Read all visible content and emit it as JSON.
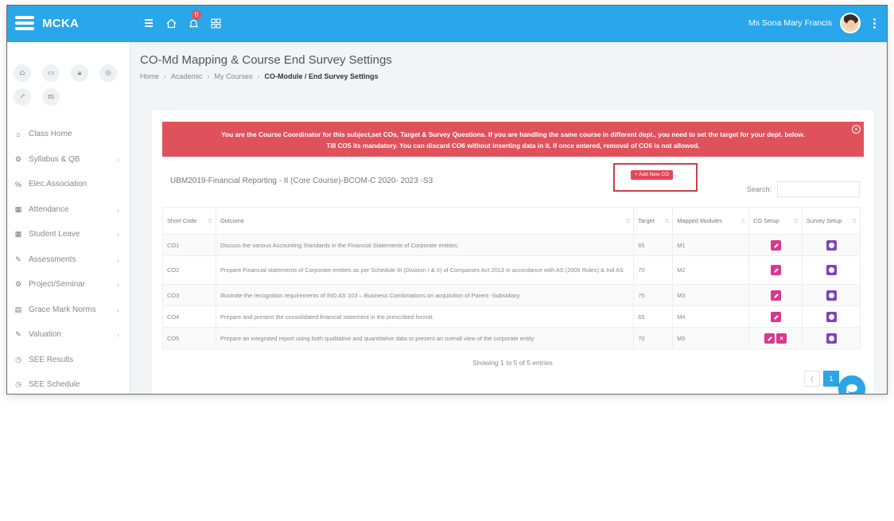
{
  "app": {
    "name": "MCKA"
  },
  "topbar": {
    "notification_count": "0",
    "user_name": "Ms Sona Mary Francis",
    "icons": [
      "list-icon",
      "home-icon",
      "bell-icon",
      "grid-icon"
    ]
  },
  "sidebar": {
    "quick_icons": [
      "home-icon",
      "id-card-icon",
      "lock-icon",
      "eye-icon",
      "external-link-icon",
      "m-icon"
    ],
    "quick_m_label": "m",
    "items": [
      {
        "label": "Class Home",
        "icon": "home-icon",
        "chevron": false
      },
      {
        "label": "Syllabus & QB",
        "icon": "gears-icon",
        "chevron": true
      },
      {
        "label": "Elec.Association",
        "icon": "percent-icon",
        "chevron": false
      },
      {
        "label": "Attendance",
        "icon": "calendar-icon",
        "chevron": true
      },
      {
        "label": "Student Leave",
        "icon": "calendar-icon",
        "chevron": true
      },
      {
        "label": "Assessments",
        "icon": "pencil-icon",
        "chevron": true
      },
      {
        "label": "Project/Seminar",
        "icon": "gears-icon",
        "chevron": true
      },
      {
        "label": "Grace Mark Norms",
        "icon": "table-icon",
        "chevron": true
      },
      {
        "label": "Valuation",
        "icon": "pencil-icon",
        "chevron": true
      },
      {
        "label": "SEE Results",
        "icon": "clock-icon",
        "chevron": false
      },
      {
        "label": "SEE Schedule",
        "icon": "clock-icon",
        "chevron": false
      }
    ]
  },
  "page": {
    "title": "CO-Md Mapping & Course End Survey Settings",
    "breadcrumb": [
      "Home",
      "Academic",
      "My Courses",
      "CO-Module / End Survey Settings"
    ]
  },
  "alert": {
    "line1": "You are the Course Coordinator for this subject,set COs, Target & Survey Questions. If you are handling the same course in different dept., you need to set the target for your dept. below.",
    "line2": "Till CO5 its mandatory. You can discard CO6 without inserting data in it. If once entered, removal of CO6 is not allowed."
  },
  "course": {
    "name": "UBM2019-Financial Reporting - II (Core Course)-BCOM-C 2020- 2023 -S3",
    "add_button": "+ Add New CO",
    "search_label": "Search:",
    "search_value": ""
  },
  "table": {
    "headers": [
      "Short Code",
      "Outcome",
      "Target",
      "Mapped Modules",
      "CO Setup",
      "Survey Setup"
    ],
    "rows": [
      {
        "code": "CO1",
        "outcome": "Discuss the various Accounting Standards in the Financial Statements of Corporate entities.",
        "target": "65",
        "module": "M1",
        "delete": false
      },
      {
        "code": "CO2",
        "outcome": "Prepare Financial statements of Corporate entities as per Schedule III (Division I & II) of Companies Act 2013 in accordance with AS (2006 Rules) & Ind AS",
        "target": "70",
        "module": "M2",
        "delete": false
      },
      {
        "code": "CO3",
        "outcome": "Illustrate the recognition requirements of IND AS 103 – Business Combinations on acquisition of Parent -Subsidiary.",
        "target": "75",
        "module": "M3",
        "delete": false
      },
      {
        "code": "CO4",
        "outcome": "Prepare and present the consolidated financial statement in the prescribed format.",
        "target": "65",
        "module": "M4",
        "delete": false
      },
      {
        "code": "CO5",
        "outcome": "Prepare an integrated report using both qualitative and quantitative data to present an overall view of the corporate entity",
        "target": "70",
        "module": "M5",
        "delete": true
      }
    ]
  },
  "footer": {
    "showing": "Showing 1 to 5 of 5 entries",
    "prev": "(",
    "page": "1"
  },
  "colors": {
    "topbar": "#29a7ea",
    "alert": "#e0525b",
    "edit": "#d63a8c",
    "survey": "#7e44b8"
  }
}
